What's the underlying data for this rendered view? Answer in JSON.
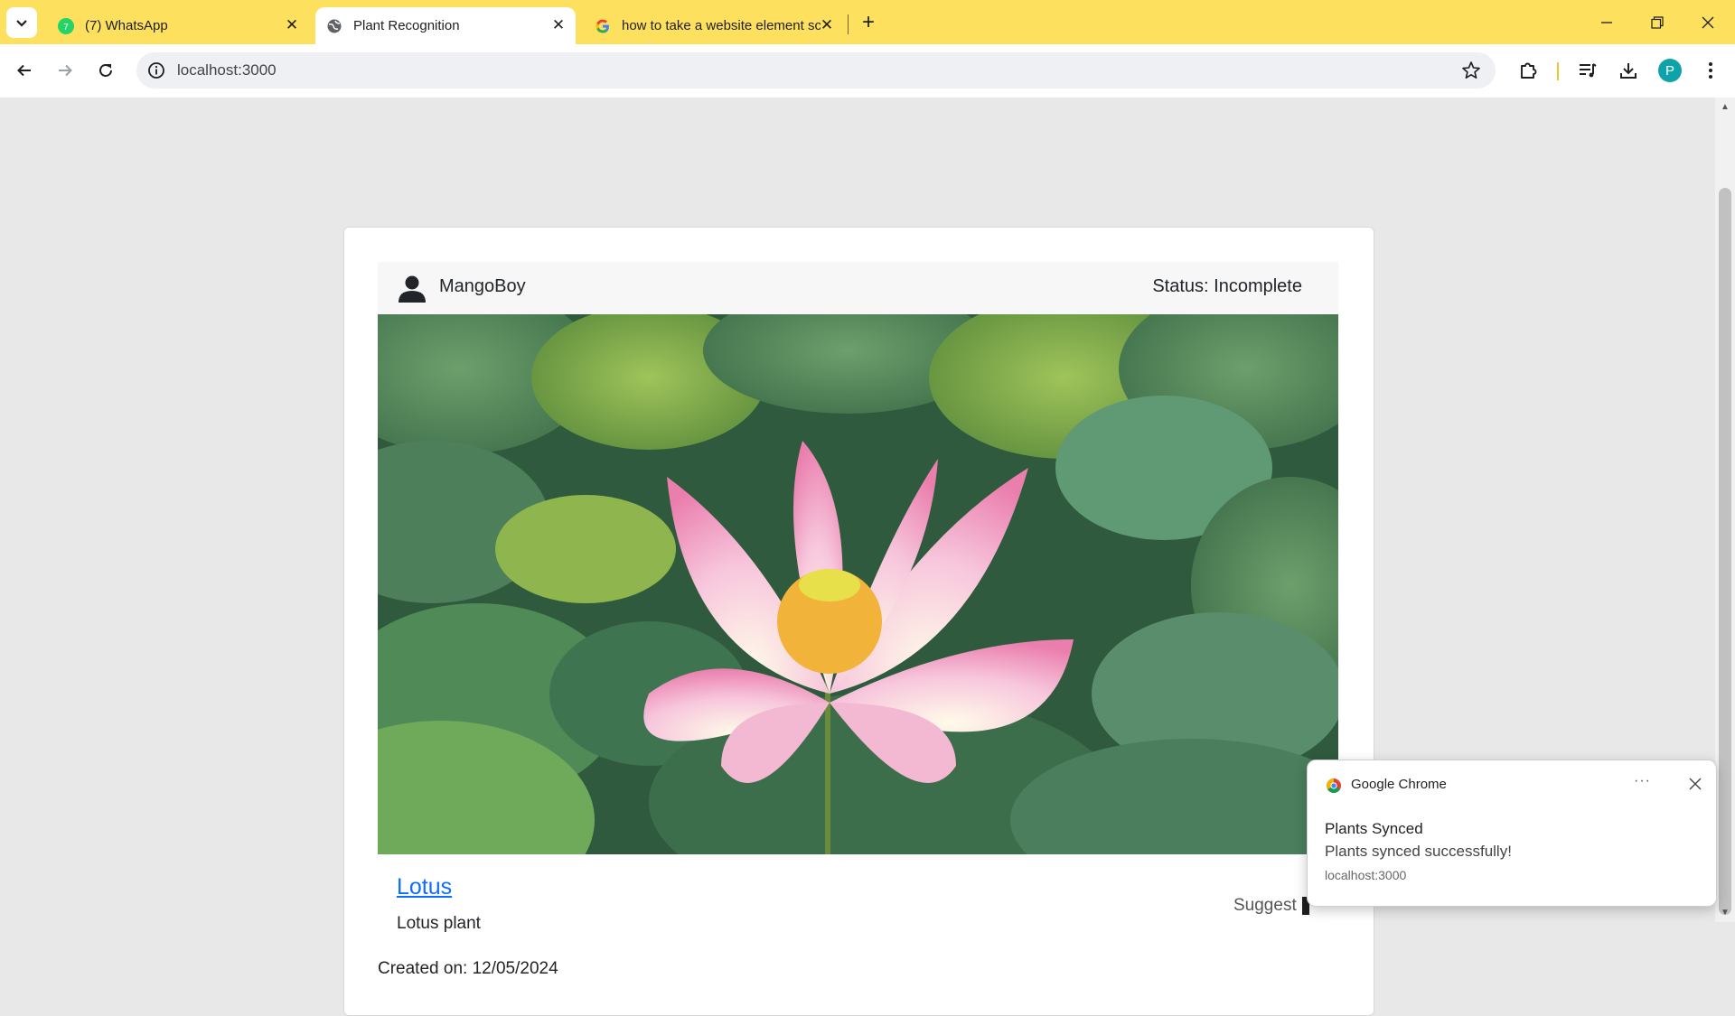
{
  "browser": {
    "tabs": [
      {
        "title": "(7) WhatsApp",
        "icon": "whatsapp-icon",
        "active": false
      },
      {
        "title": "Plant Recognition",
        "icon": "globe-icon",
        "active": true
      },
      {
        "title": "how to take a website element sc",
        "icon": "google-icon",
        "active": false
      }
    ],
    "url": "localhost:3000",
    "profile_initial": "P",
    "accent_color": "#fce05e"
  },
  "post": {
    "username": "MangoBoy",
    "status": "Status: Incomplete",
    "plant_name": "Lotus",
    "plant_description": "Lotus plant",
    "suggest_label": "Suggest",
    "created": "Created on: 12/05/2024"
  },
  "notification": {
    "app": "Google Chrome",
    "more": "···",
    "title": "Plants Synced",
    "message": "Plants synced successfully!",
    "origin": "localhost:3000"
  }
}
